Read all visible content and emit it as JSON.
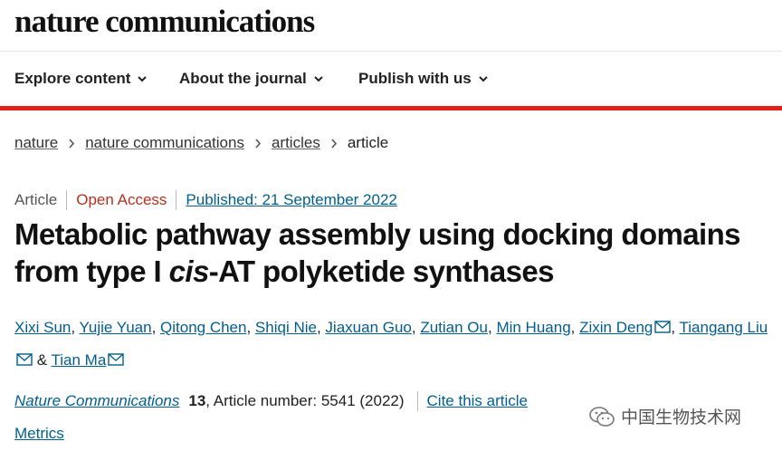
{
  "header": {
    "logo": "nature communications"
  },
  "nav": {
    "items": [
      {
        "label": "Explore content"
      },
      {
        "label": "About the journal"
      },
      {
        "label": "Publish with us"
      }
    ]
  },
  "breadcrumb": {
    "items": [
      "nature",
      "nature communications",
      "articles"
    ],
    "current": "article"
  },
  "meta": {
    "type": "Article",
    "access": "Open Access",
    "published": "Published: 21 September 2022"
  },
  "article": {
    "title_line1": "Metabolic pathway assembly using docking domains",
    "title_line2_pre": "from type I ",
    "title_line2_italic": "cis",
    "title_line2_post": "-AT polyketide synthases"
  },
  "authors": {
    "list": [
      "Xixi Sun",
      "Yujie Yuan",
      "Qitong Chen",
      "Shiqi Nie",
      "Jiaxuan Guo",
      "Zutian Ou",
      "Min Huang",
      "Zixin Deng",
      "Tiangang Liu",
      "Tian Ma"
    ],
    "separator": ", ",
    "and": "&"
  },
  "citation": {
    "journal": "Nature Communications",
    "volume": "13",
    "rest": ", Article number: 5541 (2022)",
    "cite_label": "Cite this article"
  },
  "metrics_label": "Metrics",
  "watermark": {
    "text": "中国生物技术网",
    "icon": "wechat-icon"
  },
  "colors": {
    "accent_red": "#e0201b",
    "link_blue": "#025e8d",
    "open_access": "#b3321f"
  }
}
